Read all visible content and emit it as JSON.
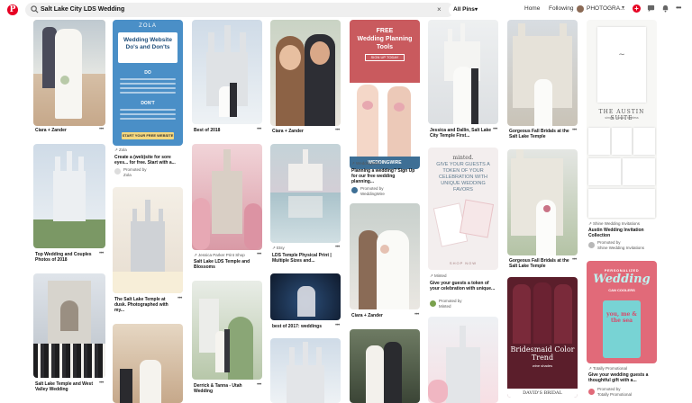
{
  "header": {
    "logo_glyph": "P",
    "search_value": "Salt Lake City LDS Wedding",
    "clear_glyph": "×",
    "pins_filter": "All Pins",
    "home": "Home",
    "following": "Following",
    "profile": "PHOTOGRA...",
    "add_glyph": "+",
    "more_glyph": "•••"
  },
  "pins": {
    "c1a": {
      "title": "Ciara + Zander"
    },
    "c1b": {
      "title": "Top Wedding and Couples Photos of 2018"
    },
    "c1c": {
      "title": "Salt Lake Temple and West Valley Wedding"
    },
    "c2a": {
      "brand": "ZOLA",
      "heading": "Wedding Website Do's and Don'ts",
      "do": "DO",
      "dont": "DON'T",
      "cta": "START YOUR FREE WEBSITE",
      "title": "Zola",
      "desc": "Create a (web)site for sore eyes... for free. Start with a...",
      "promoted": "Promoted by",
      "promoter": "Zola"
    },
    "c2b": {
      "title": "The Salt Lake Temple at dusk. Photographed with my..."
    },
    "c3a": {
      "title": "Best of 2018"
    },
    "c3b": {
      "source": "Jessica Parker Print Shop",
      "title": "Salt Lake LDS Temple and Blossoms"
    },
    "c3c": {
      "title": "Derrick & Tanna - Utah Wedding"
    },
    "c4a": {
      "title": "Ciara + Zander"
    },
    "c4b": {
      "source": "Etsy",
      "title": "LDS Temple Physical Print | Multiple Sizes and..."
    },
    "c4c": {
      "title": "best of 2017: weddings"
    },
    "c5a": {
      "free": "FREE",
      "heading": "Wedding Planning Tools",
      "btn": "SIGN UP TODAY",
      "brand_bar": "WEDDINGWIRE",
      "source": "WeddingWire",
      "title": "Planning a wedding? Sign Up for our free wedding planning...",
      "promoted": "Promoted by",
      "promoter": "WeddingWire"
    },
    "c5b": {
      "title": "Ciara + Zander"
    },
    "c6a": {
      "title": "Jessica and Dallin, Salt Lake City Temple First..."
    },
    "c6b": {
      "logo": "minted.",
      "heading": "GIVE YOUR GUESTS A TOKEN OF YOUR CELEBRATION WITH UNIQUE WEDDING FAVORS",
      "shop": "SHOP NOW",
      "source": "Minted",
      "title": "Give your guests a token of your celebration with unique...",
      "promoted": "Promoted by",
      "promoter": "Minted"
    },
    "c7a": {
      "title": "Gorgeous Fall Bridals at the Salt Lake Temple"
    },
    "c7b": {
      "title": "Gorgeous Fall Bridals at the Salt Lake Temple"
    },
    "c7c": {
      "heading": "Bridesmaid Color Trend",
      "sub": "wine shades",
      "brand": "DAVID'S BRIDAL"
    },
    "c8a": {
      "suite": "THE AUSTIN SUITE",
      "suite_sub": "simple, classic, timeless",
      "source": "Shine Wedding Invitations",
      "title": "Austin Wedding Invitation Collection",
      "promoted": "Promoted by",
      "promoter": "Shine Wedding Invitations"
    },
    "c8b": {
      "top": "PERSONALIZED",
      "big": "Wedding",
      "sub": "CAN COOLERS",
      "can": "you, me & the sea",
      "source": "Totally Promotional",
      "title": "Give your wedding guests a thoughtful gift with a...",
      "promoted": "Promoted by",
      "promoter": "Totally Promotional"
    }
  },
  "colors": {
    "brand_red": "#e60023",
    "zola_blue": "#4a8fc7",
    "weddingwire_red": "#c95a5e",
    "bridesmaid_wine": "#5b1e2b"
  }
}
